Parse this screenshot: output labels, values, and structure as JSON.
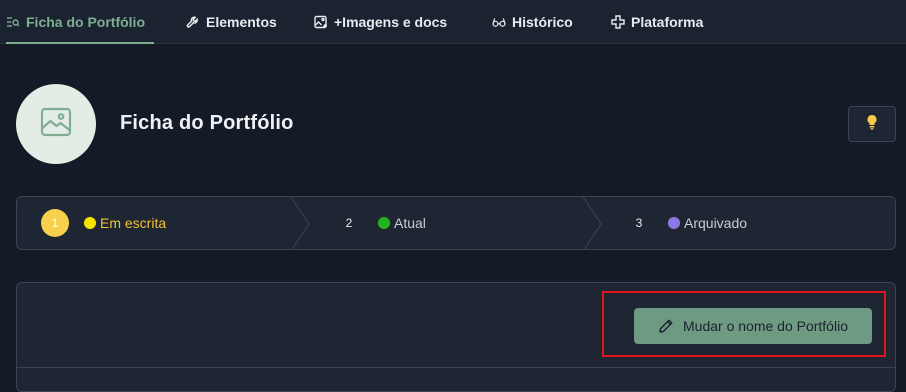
{
  "tabs": [
    {
      "label": "Ficha do Portfólio",
      "icon": "list-search-icon",
      "active": true
    },
    {
      "label": "Elementos",
      "icon": "wrench-icon",
      "active": false
    },
    {
      "label": "+Imagens e docs",
      "icon": "image-add-icon",
      "active": false
    },
    {
      "label": "Histórico",
      "icon": "glasses-icon",
      "active": false
    },
    {
      "label": "Plataforma",
      "icon": "plus-move-icon",
      "active": false
    }
  ],
  "header": {
    "title": "Ficha do Portfólio",
    "avatar_icon": "image-icon",
    "bulb_icon": "lightbulb-icon"
  },
  "stepper": {
    "steps": [
      {
        "number": "1",
        "label": "Em escrita",
        "dot_color": "#f5e400",
        "current": true
      },
      {
        "number": "2",
        "label": "Atual",
        "dot_color": "#22b41e",
        "current": false
      },
      {
        "number": "3",
        "label": "Arquivado",
        "dot_color": "#8a78e6",
        "current": false
      }
    ]
  },
  "panel": {
    "rename_label": "Mudar o nome do Portfólio",
    "rename_icon": "pencil-icon"
  },
  "colors": {
    "accent": "#7fae92",
    "button": "#6f9a82",
    "highlight": "#e0141c",
    "background": "#141b26"
  }
}
